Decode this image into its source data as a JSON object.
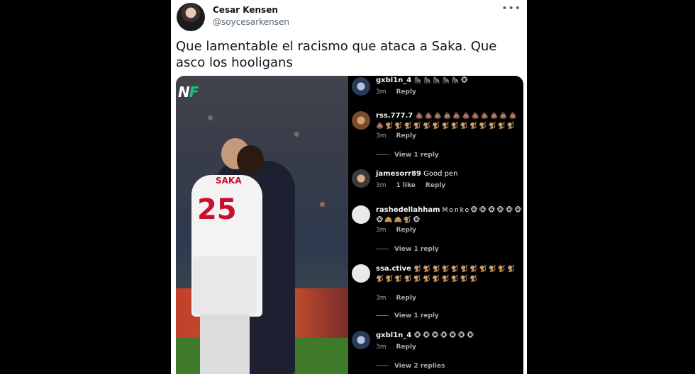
{
  "tweet": {
    "author_name": "Cesar Kensen",
    "author_handle": "@soycesarkensen",
    "more_glyph": "•••",
    "text": "Que lamentable el racismo que ataca a Saka. Que asco los hooligans"
  },
  "photo": {
    "logo_left": "N",
    "logo_right": "F",
    "jersey_name": "SAKA",
    "jersey_number": "25"
  },
  "comments": [
    {
      "user": "gxbl1n_4",
      "text": "🦍🦍🦍🦍🦍🐵",
      "time": "3m",
      "likes": "",
      "reply": "Reply",
      "view_replies": ""
    },
    {
      "user": "rss.777.7",
      "text": "💩💩💩💩💩💩💩💩💩💩💩💩🐒🐒🐒🐒🐒🐒🐒🐒🐒🐒🐒🐒🐒🐒",
      "time": "3m",
      "likes": "",
      "reply": "Reply",
      "view_replies": "View 1 reply"
    },
    {
      "user": "jamesorr89",
      "text": "Good pen",
      "time": "3m",
      "likes": "1 like",
      "reply": "Reply",
      "view_replies": ""
    },
    {
      "user": "rashedellahham",
      "text": "Monke🐵🐵🐵🐵🐵🐵🐵🙈🙈🐒🐵",
      "time": "3m",
      "likes": "",
      "reply": "Reply",
      "view_replies": "View 1 reply"
    },
    {
      "user": "ssa.ctive",
      "text": "🐒🐒🐒🐒🐒🐒🐒🐒🐒🐒🐒🐒🐒🐒🐒🐒🐒🐒🐒🐒🐒🐒",
      "time": "3m",
      "likes": "",
      "reply": "Reply",
      "view_replies": "View 1 reply"
    },
    {
      "user": "gxbl1n_4",
      "text": "🐵🐵🐵🐵🐵🐵🐵",
      "time": "3m",
      "likes": "",
      "reply": "Reply",
      "view_replies": "View 2 replies"
    }
  ]
}
